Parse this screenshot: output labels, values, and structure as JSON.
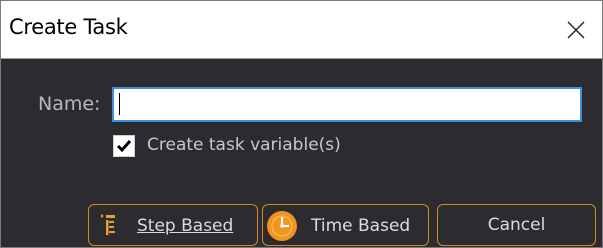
{
  "window": {
    "title": "Create Task",
    "close_icon": "close-x-icon"
  },
  "form": {
    "name_label": "Name:",
    "name_value": "",
    "create_variables_label": "Create task variable(s)",
    "create_variables_checked": true
  },
  "buttons": {
    "step_based_label": "Step Based",
    "step_based_icon": "step-list-icon",
    "time_based_label": "Time Based",
    "time_based_icon": "clock-icon",
    "cancel_label": "Cancel"
  },
  "colors": {
    "accent_orange": "#d9881f",
    "focus_blue": "#3d8fe0",
    "dialog_bg": "#2c2c30"
  }
}
